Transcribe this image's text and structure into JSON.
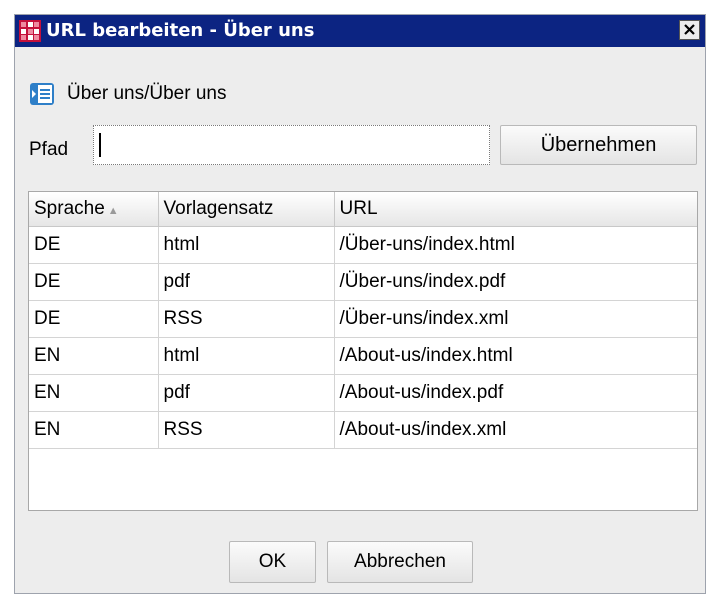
{
  "window": {
    "title": "URL bearbeiten - Über uns",
    "close_label": "×"
  },
  "breadcrumb": {
    "text": "Über uns/Über uns"
  },
  "path": {
    "label": "Pfad",
    "value": "",
    "apply_label": "Übernehmen"
  },
  "table": {
    "columns": [
      "Sprache",
      "Vorlagensatz",
      "URL"
    ],
    "sort_column": "Sprache",
    "sort_direction": "ascending",
    "rows": [
      [
        "DE",
        "html",
        "/Über-uns/index.html"
      ],
      [
        "DE",
        "pdf",
        "/Über-uns/index.pdf"
      ],
      [
        "DE",
        "RSS",
        "/Über-uns/index.xml"
      ],
      [
        "EN",
        "html",
        "/About-us/index.html"
      ],
      [
        "EN",
        "pdf",
        "/About-us/index.pdf"
      ],
      [
        "EN",
        "RSS",
        "/About-us/index.xml"
      ]
    ]
  },
  "footer": {
    "ok_label": "OK",
    "cancel_label": "Abbrechen"
  },
  "icons": {
    "title": "app-logo-icon",
    "breadcrumb": "page-icon",
    "sort": "sort-ascending-icon"
  },
  "colors": {
    "titlebar": "#0c2482",
    "window_bg": "#ededed",
    "logo_red": "#c4103b"
  }
}
